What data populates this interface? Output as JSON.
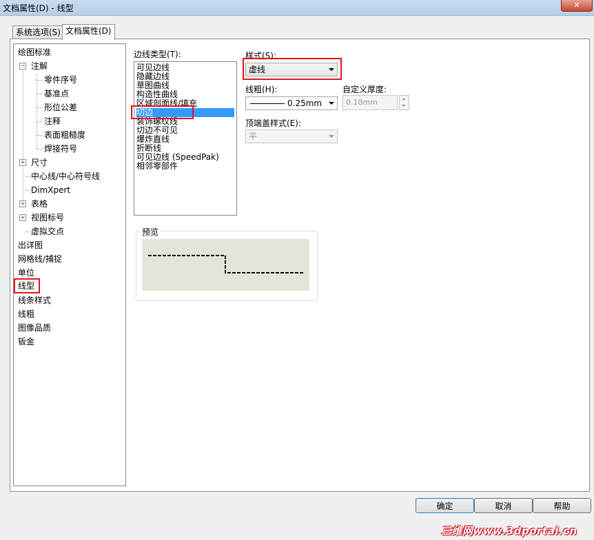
{
  "window": {
    "title": "文档属性(D) - 线型",
    "close": "✕"
  },
  "tabs": [
    {
      "label": "系统选项(S)"
    },
    {
      "label": "文档属性(D)"
    }
  ],
  "tree": {
    "items": [
      {
        "label": "绘图标准"
      },
      {
        "label": "注解"
      },
      {
        "label": "零件序号"
      },
      {
        "label": "基准点"
      },
      {
        "label": "形位公差"
      },
      {
        "label": "注释"
      },
      {
        "label": "表面粗糙度"
      },
      {
        "label": "焊接符号"
      },
      {
        "label": "尺寸"
      },
      {
        "label": "中心线/中心符号线"
      },
      {
        "label": "DimXpert"
      },
      {
        "label": "表格"
      },
      {
        "label": "视图标号"
      },
      {
        "label": "虚拟交点"
      },
      {
        "label": "出详图"
      },
      {
        "label": "网格线/捕捉"
      },
      {
        "label": "单位"
      },
      {
        "label": "线型"
      },
      {
        "label": "线条样式"
      },
      {
        "label": "线粗"
      },
      {
        "label": "图像品质"
      },
      {
        "label": "钣金"
      }
    ],
    "selected": "线型"
  },
  "edge_types": {
    "label": "边线类型(T):",
    "items": [
      "可见边线",
      "隐藏边线",
      "草图曲线",
      "构造性曲线",
      "区域剖面线/填充",
      "切边",
      "装饰螺纹线",
      "切边不可见",
      "爆炸直线",
      "折断线",
      "可见边线 (SpeedPak)",
      "相邻零部件"
    ],
    "selected": "切边"
  },
  "style": {
    "label": "样式(S):",
    "value": "虚线"
  },
  "thickness": {
    "label": "线粗(H):",
    "value": "0.25mm"
  },
  "custom_thickness": {
    "label": "自定义厚度:",
    "value": "0.18mm"
  },
  "end_cap": {
    "label": "顶端盖样式(E):",
    "value": "平"
  },
  "preview": {
    "label": "预览"
  },
  "buttons": {
    "ok": "确定",
    "cancel": "取消",
    "help": "帮助"
  },
  "watermark": "三维网www.3dportal.cn",
  "colors": {
    "selection": "#3399ff",
    "highlight_box": "#e0141c",
    "preview_bg": "#e6e3d8"
  }
}
